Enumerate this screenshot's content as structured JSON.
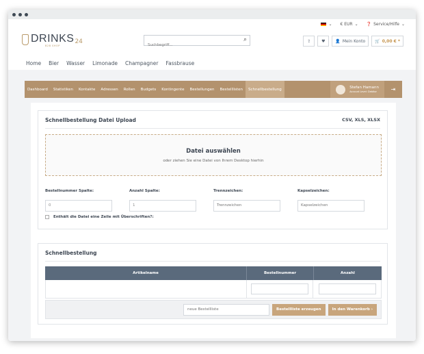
{
  "topbar": {
    "currency": "€ EUR",
    "service": "Service/Hilfe"
  },
  "logo": {
    "name": "DRINKS",
    "suffix": "24",
    "tagline": "B2B SHOP"
  },
  "search": {
    "placeholder": "Suchbegriff..."
  },
  "header": {
    "account_label": "Mein Konto",
    "cart_total": "0,00 € *"
  },
  "categories": [
    "Home",
    "Bier",
    "Wasser",
    "Limonade",
    "Champagner",
    "Fassbrause"
  ],
  "dashboard": {
    "items": [
      "Dashboard",
      "Statistiken",
      "Kontakte",
      "Adressen",
      "Rollen",
      "Budgets",
      "Kontingente",
      "Bestellungen",
      "Bestelllisten",
      "Schnellbestellung"
    ],
    "active_index": 9,
    "user_name": "Stefan Hamann",
    "user_level": "Account Level: Debitor"
  },
  "upload": {
    "title": "Schnellbestellung Datei Upload",
    "formats": "CSV, XLS, XLSX",
    "dz_title": "Datei auswählen",
    "dz_sub": "oder ziehen Sie eine Datei von Ihrem Desktop hierhin",
    "fields": [
      {
        "label": "Bestellnummer Spalte:",
        "value": "0"
      },
      {
        "label": "Anzahl Spalte:",
        "value": "1"
      },
      {
        "label": "Trennzeichen:",
        "placeholder": "Trennzeichen"
      },
      {
        "label": "Kapselzeichen:",
        "placeholder": "Kapselzeichen"
      }
    ],
    "checkbox_label": "Enthält die Datei eine Zeile mit Überschriften?:"
  },
  "quick": {
    "title": "Schnellbestellung",
    "columns": [
      "Artikelname",
      "Bestellnummer",
      "Anzahl"
    ],
    "list_placeholder": "neue Bestellliste",
    "create_list_label": "Bestellliste erzeugen",
    "to_cart_label": "In den Warenkorb ›"
  },
  "colors": {
    "accent": "#b3926d",
    "table_header": "#5a6a7c",
    "button": "#c8a57c"
  }
}
